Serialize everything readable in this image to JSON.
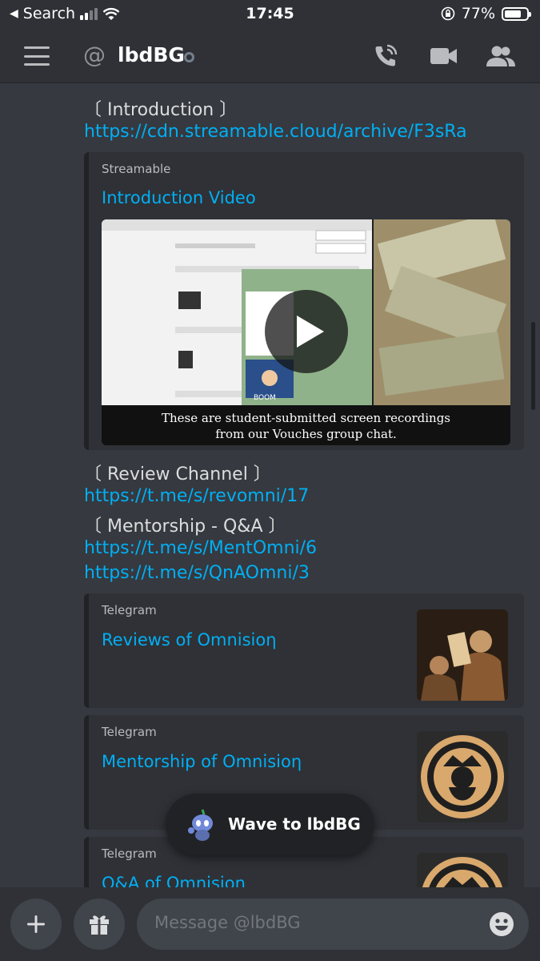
{
  "status_bar": {
    "back_label": "Search",
    "time": "17:45",
    "battery": "77%",
    "battery_level": 0.77
  },
  "header": {
    "at_symbol": "@",
    "name": "lbdBG"
  },
  "messages": [
    {
      "type": "text",
      "text": "〔 Introduction 〕"
    },
    {
      "type": "link",
      "text": "https://cdn.streamable.cloud/archive/F3sRa"
    }
  ],
  "embed_video": {
    "provider": "Streamable",
    "title": "Introduction Video",
    "caption_line1": "These are student-submitted screen recordings",
    "caption_line2": "from our Vouches group chat.",
    "screen_text": "BOOM"
  },
  "messages2": [
    {
      "type": "text",
      "text": "〔 Review Channel 〕"
    },
    {
      "type": "link",
      "text": "https://t.me/s/revomni/17"
    },
    {
      "type": "text",
      "text": "〔 Mentorship - Q&A 〕"
    },
    {
      "type": "link",
      "text": "https://t.me/s/MentOmni/6"
    },
    {
      "type": "link",
      "text": "https://t.me/s/QnAOmni/3"
    }
  ],
  "embeds": [
    {
      "provider": "Telegram",
      "title": "Reviews of Omnisioη"
    },
    {
      "provider": "Telegram",
      "title": "Mentorship of Omnisioη"
    },
    {
      "provider": "Telegram",
      "title": "Q&A of Omnision"
    }
  ],
  "wave": {
    "label": "Wave to lbdBG"
  },
  "composer": {
    "placeholder": "Message @lbdBG"
  },
  "colors": {
    "background": "#36393f",
    "link": "#00aff4",
    "surface": "#2f3136"
  }
}
